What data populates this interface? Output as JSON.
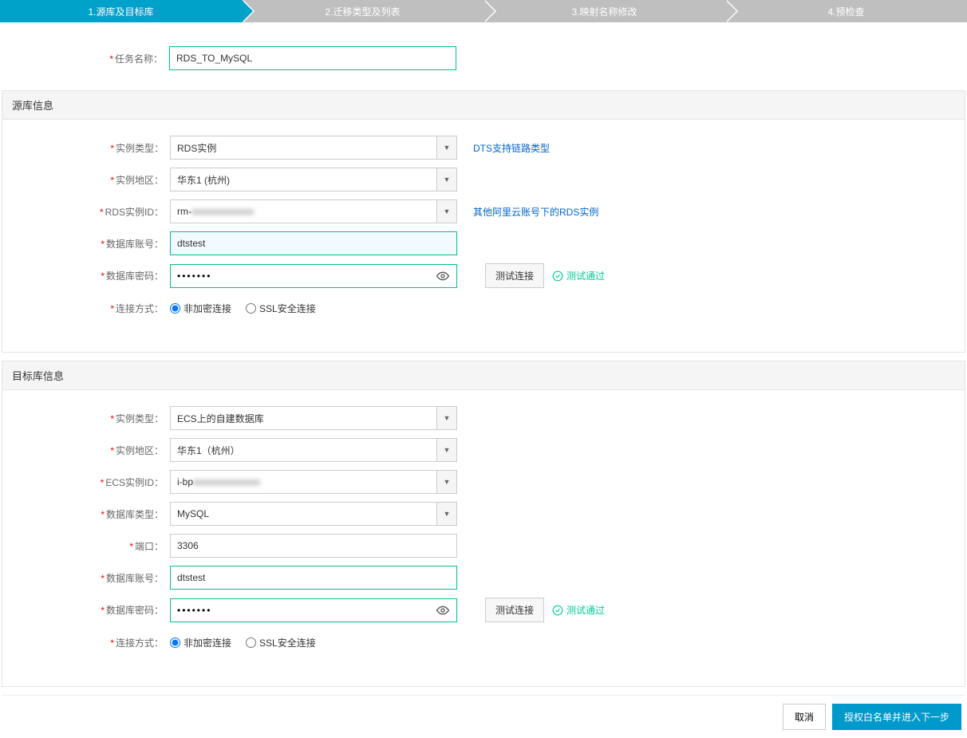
{
  "steps": {
    "s1": "1.源库及目标库",
    "s2": "2.迁移类型及列表",
    "s3": "3.映射名称修改",
    "s4": "4.预检查"
  },
  "task": {
    "label": "任务名称：",
    "value": "RDS_TO_MySQL"
  },
  "source": {
    "header": "源库信息",
    "instance_type_label": "实例类型：",
    "instance_type_value": "RDS实例",
    "link_types": "DTS支持链路类型",
    "region_label": "实例地区：",
    "region_value": "华东1 (杭州)",
    "rds_id_label": "RDS实例ID：",
    "rds_id_prefix": "rm-",
    "rds_id_blur": "xxxxxxxxxxxxx",
    "other_account": "其他阿里云账号下的RDS实例",
    "account_label": "数据库账号：",
    "account_value": "dtstest",
    "password_label": "数据库密码：",
    "password_value": "•••••••",
    "test_btn": "测试连接",
    "test_result": "测试通过",
    "conn_label": "连接方式：",
    "conn_plain": "非加密连接",
    "conn_ssl": "SSL安全连接"
  },
  "target": {
    "header": "目标库信息",
    "instance_type_label": "实例类型：",
    "instance_type_value": "ECS上的自建数据库",
    "region_label": "实例地区：",
    "region_value": "华东1（杭州）",
    "ecs_id_label": "ECS实例ID：",
    "ecs_id_prefix": "i-bp",
    "ecs_id_blur": "xxxxxxxxxxxxxx",
    "db_type_label": "数据库类型：",
    "db_type_value": "MySQL",
    "port_label": "端口：",
    "port_value": "3306",
    "account_label": "数据库账号：",
    "account_value": "dtstest",
    "password_label": "数据库密码：",
    "password_value": "•••••••",
    "test_btn": "测试连接",
    "test_result": "测试通过",
    "conn_label": "连接方式：",
    "conn_plain": "非加密连接",
    "conn_ssl": "SSL安全连接"
  },
  "footer": {
    "cancel": "取消",
    "next": "授权白名单并进入下一步"
  }
}
